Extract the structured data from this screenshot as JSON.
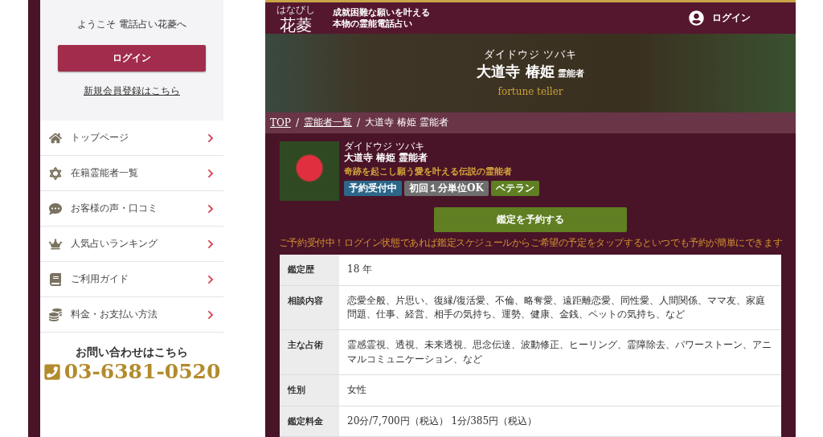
{
  "sidebar": {
    "welcome": "ようこそ 電話占い花菱へ",
    "login_button": "ログイン",
    "register_link": "新規会員登録はこちら",
    "menu": [
      {
        "label": "トップページ"
      },
      {
        "label": "在籍霊能者一覧"
      },
      {
        "label": "お客様の声・口コミ"
      },
      {
        "label": "人気占いランキング"
      },
      {
        "label": "ご利用ガイド"
      },
      {
        "label": "料金・お支払い方法"
      }
    ],
    "contact": {
      "heading": "お問い合わせはこちら",
      "phone": "03-6381-0520"
    }
  },
  "header": {
    "logo_ruby": "はなびし",
    "logo": "花菱",
    "tagline": [
      "成就困難な願いを叶える",
      "本物の霊能電話占い"
    ],
    "login": "ログイン"
  },
  "hero": {
    "ruby": "ダイドウジ ツバキ",
    "name": "大道寺 椿姫",
    "title": "霊能者",
    "subtitle": "fortune teller"
  },
  "breadcrumb_separators": [
    "/",
    "/"
  ],
  "breadcrumb": [
    {
      "label": "TOP",
      "link": true
    },
    {
      "label": "霊能者一覧",
      "link": true
    },
    {
      "label": "大道寺 椿姫 霊能者",
      "link": false
    }
  ],
  "profile": {
    "ruby": "ダイドウジ ツバキ",
    "name": "大道寺 椿姫 霊能者",
    "catchphrase": "奇跡を起こし願う愛を叶える伝説の霊能者",
    "badges": [
      {
        "label": "予約受付中",
        "color": "#2b6789"
      },
      {
        "label": "初回１分単位OK",
        "color": "#6e6e6e"
      },
      {
        "label": "ベテラン",
        "color": "#5f7f22"
      }
    ]
  },
  "reserve_button": "鑑定を予約する",
  "notice": "ご予約受付中！ログイン状態であれば鑑定スケジュールからご希望の予定をタップするといつでも予約が簡単にできます",
  "details": [
    {
      "label": "鑑定歴",
      "value": "18 年"
    },
    {
      "label": "相談内容",
      "value": "恋愛全般、片思い、復縁/復活愛、不倫、略奪愛、遠距離恋愛、同性愛、人間関係、ママ友、家庭問題、仕事、経営、相手の気持ち、運勢、健康、金銭、ペットの気持ち、など"
    },
    {
      "label": "主な占術",
      "value": "霊感霊視、透視、未来透視、思念伝達、波動修正、ヒーリング、霊障除去、パワーストーン、アニマルコミュニケーション、など"
    },
    {
      "label": "性別",
      "value": "女性"
    },
    {
      "label": "鑑定料金",
      "value": "20分/7,700円（税込） 1分/385円（税込）"
    }
  ]
}
